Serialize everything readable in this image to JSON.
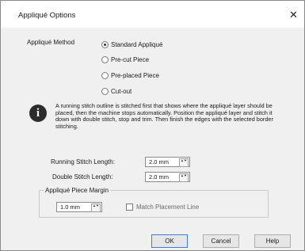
{
  "dialog": {
    "title": "Appliqué Options",
    "close_glyph": "✕"
  },
  "method": {
    "label": "Appliqué Method",
    "options": [
      {
        "label": "Standard Appliqué",
        "selected": true
      },
      {
        "label": "Pre-cut Piece",
        "selected": false
      },
      {
        "label": "Pre-placed Piece",
        "selected": false
      },
      {
        "label": "Cut-out",
        "selected": false
      }
    ]
  },
  "info": {
    "icon": "info-icon",
    "glyph": "i",
    "text": "A running stitch outline is stitched first that shows where the appliqué layer should be placed, then the machine stops automatically. Position the appliqué layer and stitch it down with double stitch, stop and trim. Then finish the edges with the selected border stitching."
  },
  "running_stitch": {
    "label": "Running Stitch Length:",
    "value": "2.0 mm"
  },
  "double_stitch": {
    "label": "Double Stitch Length:",
    "value": "2.0 mm"
  },
  "margin_group": {
    "title": "Appliqué Piece Margin",
    "value": "1.0 mm",
    "match_label": "Match Placement Line",
    "match_checked": false
  },
  "buttons": {
    "ok": "OK",
    "cancel": "Cancel",
    "help": "Help"
  },
  "spin_glyph": "▲▼"
}
